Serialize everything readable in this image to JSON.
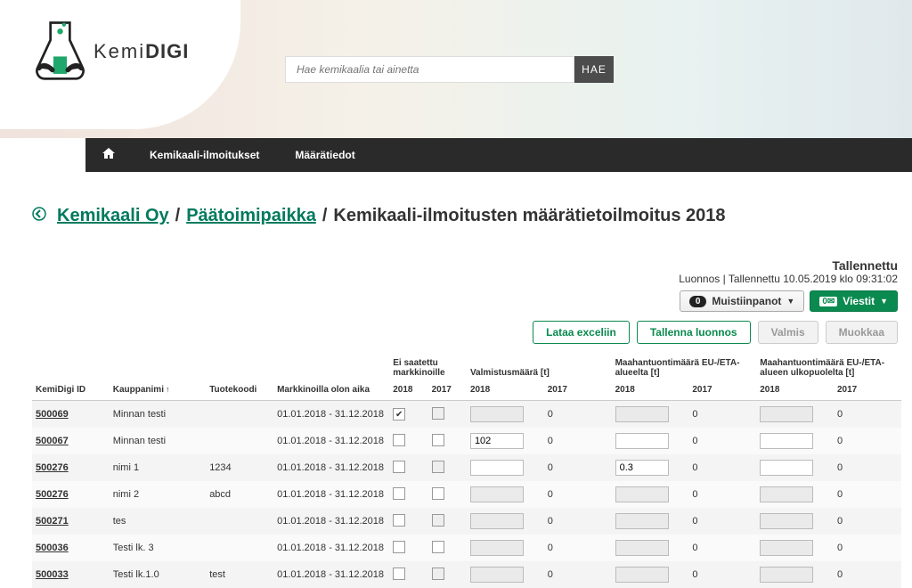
{
  "logo": {
    "text_light": "Kemi",
    "text_bold": "DIGI"
  },
  "search": {
    "placeholder": "Hae kemikaalia tai ainetta",
    "button": "HAE"
  },
  "nav": {
    "item1": "Kemikaali-ilmoitukset",
    "item2": "Määrätiedot"
  },
  "breadcrumb": {
    "back_icon": "◀",
    "link1": "Kemikaali Oy",
    "link2": "Päätoimipaikka",
    "current": "Kemikaali-ilmoitusten määrätietoilmoitus 2018",
    "sep": "/"
  },
  "status": {
    "saved": "Tallennettu",
    "meta": "Luonnos  |  Tallennettu 10.05.2019 klo 09:31:02",
    "notes_count": "0",
    "notes_label": "Muistiinpanot",
    "messages_count": "0",
    "messages_label": "Viestit"
  },
  "actions": {
    "download": "Lataa exceliin",
    "save_draft": "Tallenna luonnos",
    "ready": "Valmis",
    "edit": "Muokkaa"
  },
  "headers": {
    "id": "KemiDigi ID",
    "name": "Kauppanimi",
    "code": "Tuotekoodi",
    "period": "Markkinoilla olon aika",
    "not_marketed": "Ei saatettu markkinoille",
    "manufactured": "Valmistusmäärä [t]",
    "import_eu": "Maahantuontimäärä EU-/ETA-alueelta [t]",
    "import_out": "Maahantuontimäärä EU-/ETA-alueen ulkopuolelta [t]",
    "y2018": "2018",
    "y2017": "2017"
  },
  "rows": [
    {
      "id": "500069",
      "name": "Minnan testi",
      "code": "",
      "period": "01.01.2018 - 31.12.2018",
      "chk18": true,
      "chk17": false,
      "val18": "",
      "val17": "0",
      "eu18": "",
      "eu17": "0",
      "out18": "",
      "out17": "0"
    },
    {
      "id": "500067",
      "name": "Minnan testi",
      "code": "",
      "period": "01.01.2018 - 31.12.2018",
      "chk18": false,
      "chk17": false,
      "val18": "102",
      "val17": "0",
      "eu18": "",
      "eu17": "0",
      "out18": "",
      "out17": "0"
    },
    {
      "id": "500276",
      "name": "nimi 1",
      "code": "1234",
      "period": "01.01.2018 - 31.12.2018",
      "chk18": false,
      "chk17": false,
      "val18": "",
      "val17": "0",
      "eu18": "0.3",
      "eu17": "0",
      "out18": "",
      "out17": "0"
    },
    {
      "id": "500276",
      "name": "nimi 2",
      "code": "abcd",
      "period": "01.01.2018 - 31.12.2018",
      "chk18": false,
      "chk17": false,
      "val18": "",
      "val17": "0",
      "eu18": "",
      "eu17": "0",
      "out18": "",
      "out17": "0"
    },
    {
      "id": "500271",
      "name": "tes",
      "code": "",
      "period": "01.01.2018 - 31.12.2018",
      "chk18": false,
      "chk17": false,
      "val18": "",
      "val17": "0",
      "eu18": "",
      "eu17": "0",
      "out18": "",
      "out17": "0"
    },
    {
      "id": "500036",
      "name": "Testi lk. 3",
      "code": "",
      "period": "01.01.2018 - 31.12.2018",
      "chk18": false,
      "chk17": false,
      "val18": "",
      "val17": "0",
      "eu18": "",
      "eu17": "0",
      "out18": "",
      "out17": "0"
    },
    {
      "id": "500033",
      "name": "Testi lk.1.0",
      "code": "test",
      "period": "01.01.2018 - 31.12.2018",
      "chk18": false,
      "chk17": false,
      "val18": "",
      "val17": "0",
      "eu18": "",
      "eu17": "0",
      "out18": "",
      "out17": "0"
    }
  ]
}
